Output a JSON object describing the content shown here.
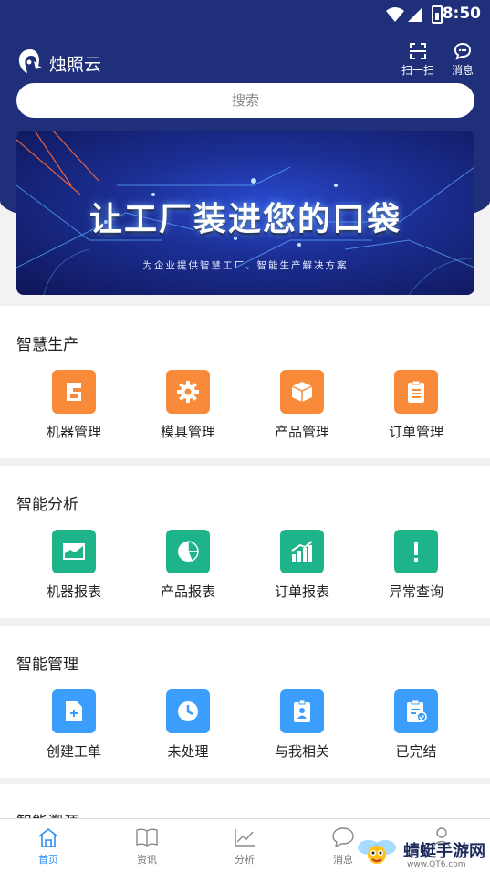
{
  "status_bar": {
    "time": "8:50"
  },
  "header": {
    "app_title": "烛照云",
    "scan_label": "扫一扫",
    "message_label": "消息"
  },
  "search": {
    "placeholder": "搜索"
  },
  "banner": {
    "title": "让工厂装进您的口袋",
    "subtitle": "为企业提供智慧工厂、智能生产解决方案"
  },
  "sections": [
    {
      "title": "智慧生产",
      "items": [
        {
          "label": "机器管理",
          "icon": "machine-icon",
          "color": "#f98a3a"
        },
        {
          "label": "模具管理",
          "icon": "gear-icon",
          "color": "#f98a3a"
        },
        {
          "label": "产品管理",
          "icon": "box-icon",
          "color": "#f98a3a"
        },
        {
          "label": "订单管理",
          "icon": "clipboard-icon",
          "color": "#f98a3a"
        }
      ]
    },
    {
      "title": "智能分析",
      "items": [
        {
          "label": "机器报表",
          "icon": "area-chart-icon",
          "color": "#1fb38a"
        },
        {
          "label": "产品报表",
          "icon": "pie-chart-icon",
          "color": "#1fb38a"
        },
        {
          "label": "订单报表",
          "icon": "bar-chart-icon",
          "color": "#1fb38a"
        },
        {
          "label": "异常查询",
          "icon": "exclamation-icon",
          "color": "#1fb38a"
        }
      ]
    },
    {
      "title": "智能管理",
      "items": [
        {
          "label": "创建工单",
          "icon": "new-document-icon",
          "color": "#3b9dfc"
        },
        {
          "label": "未处理",
          "icon": "clock-icon",
          "color": "#3b9dfc"
        },
        {
          "label": "与我相关",
          "icon": "user-badge-icon",
          "color": "#3b9dfc"
        },
        {
          "label": "已完结",
          "icon": "completed-clipboard-icon",
          "color": "#3b9dfc"
        }
      ]
    },
    {
      "title": "智能溯源"
    }
  ],
  "bottom_nav": [
    {
      "label": "首页",
      "icon": "home-icon",
      "active": true
    },
    {
      "label": "资讯",
      "icon": "book-icon",
      "active": false
    },
    {
      "label": "分析",
      "icon": "line-chart-icon",
      "active": false
    },
    {
      "label": "消息",
      "icon": "chat-icon",
      "active": false
    },
    {
      "label": "",
      "icon": "user-icon",
      "active": false
    }
  ],
  "watermark": {
    "text": "蜻蜓手游网",
    "url": "www.QT6.com"
  },
  "colors": {
    "header_bg": "#1f2f7a",
    "orange": "#f98a3a",
    "green": "#1fb38a",
    "blue": "#3b9dfc",
    "active_nav": "#2f8ef5"
  }
}
